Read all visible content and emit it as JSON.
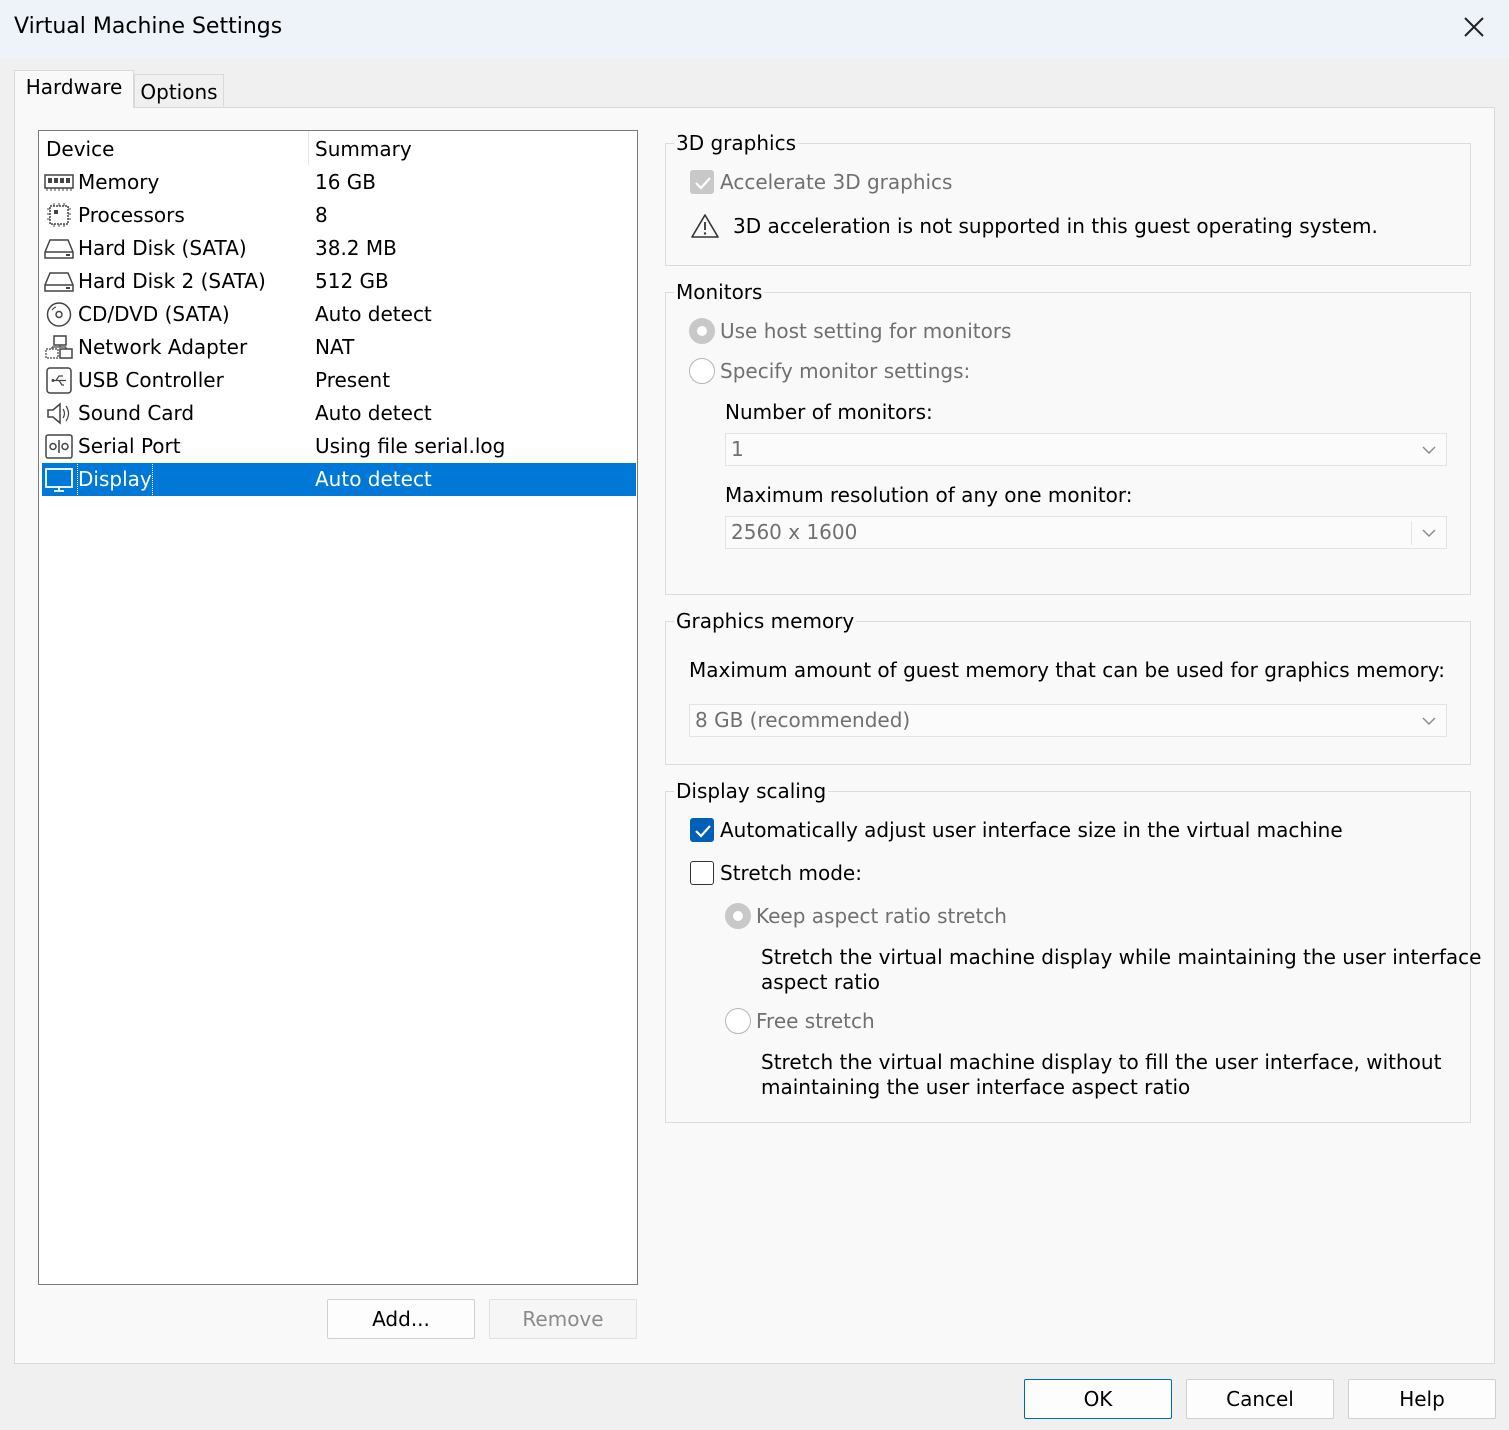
{
  "window": {
    "title": "Virtual Machine Settings"
  },
  "tabs": [
    {
      "label": "Hardware"
    },
    {
      "label": "Options"
    }
  ],
  "device_list": {
    "columns": {
      "device": "Device",
      "summary": "Summary"
    },
    "rows": [
      {
        "device": "Memory",
        "summary": "16 GB",
        "icon": "memory-icon"
      },
      {
        "device": "Processors",
        "summary": "8",
        "icon": "processor-icon"
      },
      {
        "device": "Hard Disk (SATA)",
        "summary": "38.2 MB",
        "icon": "hard-disk-icon"
      },
      {
        "device": "Hard Disk 2 (SATA)",
        "summary": "512 GB",
        "icon": "hard-disk-icon"
      },
      {
        "device": "CD/DVD (SATA)",
        "summary": "Auto detect",
        "icon": "cd-dvd-icon"
      },
      {
        "device": "Network Adapter",
        "summary": "NAT",
        "icon": "network-icon"
      },
      {
        "device": "USB Controller",
        "summary": "Present",
        "icon": "usb-icon"
      },
      {
        "device": "Sound Card",
        "summary": "Auto detect",
        "icon": "speaker-icon"
      },
      {
        "device": "Serial Port",
        "summary": "Using file serial.log",
        "icon": "serial-port-icon"
      },
      {
        "device": "Display",
        "summary": "Auto detect",
        "icon": "display-icon",
        "selected": true
      }
    ]
  },
  "list_buttons": {
    "add": "Add...",
    "remove": "Remove"
  },
  "graphics3d": {
    "label": "3D graphics",
    "accelerate": "Accelerate 3D graphics",
    "warning": "3D acceleration is not supported in this guest operating system."
  },
  "monitors": {
    "label": "Monitors",
    "use_host": "Use host setting for monitors",
    "specify": "Specify monitor settings:",
    "number_label": "Number of monitors:",
    "number_value": "1",
    "resolution_label": "Maximum resolution of any one monitor:",
    "resolution_value": "2560 x 1600"
  },
  "graphics_memory": {
    "label": "Graphics memory",
    "description": "Maximum amount of guest memory that can be used for graphics memory:",
    "value": "8 GB (recommended)"
  },
  "display_scaling": {
    "label": "Display scaling",
    "auto_adjust": "Automatically adjust user interface size in the virtual machine",
    "stretch_mode": "Stretch mode:",
    "keep_aspect": "Keep aspect ratio stretch",
    "keep_aspect_desc_1": "Stretch the virtual machine display while maintaining the user interface",
    "keep_aspect_desc_2": "aspect ratio",
    "free_stretch": "Free stretch",
    "free_stretch_desc_1": "Stretch the virtual machine display to fill the user interface, without",
    "free_stretch_desc_2": "maintaining the user interface aspect ratio"
  },
  "footer": {
    "ok": "OK",
    "cancel": "Cancel",
    "help": "Help"
  },
  "colors": {
    "accent": "#0078d7",
    "checkbox_checked": "#005fb8",
    "disabled_text": "#707070"
  }
}
